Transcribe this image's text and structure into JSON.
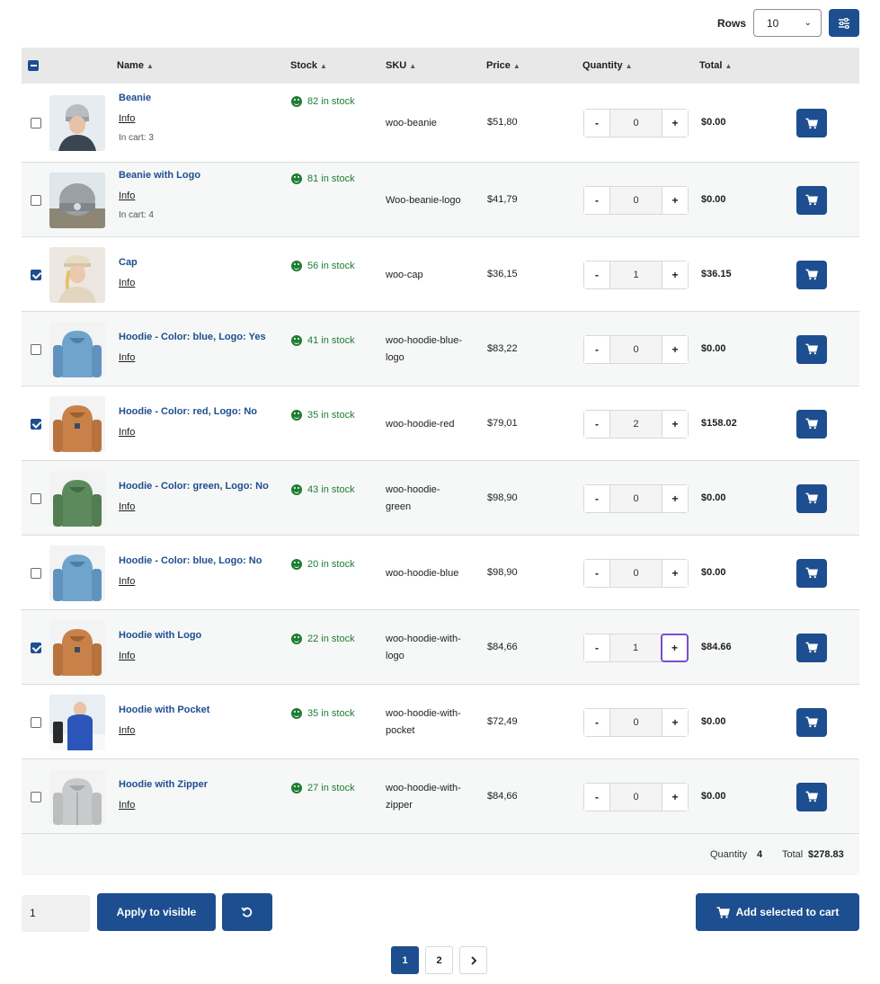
{
  "rows_control": {
    "label": "Rows",
    "value": "10"
  },
  "columns": {
    "name": "Name",
    "stock": "Stock",
    "sku": "SKU",
    "price": "Price",
    "quantity": "Quantity",
    "total": "Total"
  },
  "products": [
    {
      "name": "Beanie",
      "info": "Info",
      "in_cart": "In cart: 3",
      "stock": "82 in stock",
      "sku": [
        "woo-beanie"
      ],
      "price": "$51,80",
      "qty": "0",
      "total": "$0.00",
      "checked": false,
      "thumb": "beanie"
    },
    {
      "name": "Beanie with Logo",
      "info": "Info",
      "in_cart": "In cart: 4",
      "stock": "81 in stock",
      "sku": [
        "Woo-beanie-logo"
      ],
      "price": "$41,79",
      "qty": "0",
      "total": "$0.00",
      "checked": false,
      "thumb": "beanie-logo"
    },
    {
      "name": "Cap",
      "info": "Info",
      "in_cart": "",
      "stock": "56 in stock",
      "sku": [
        "woo-cap"
      ],
      "price": "$36,15",
      "qty": "1",
      "total": "$36.15",
      "checked": true,
      "thumb": "cap"
    },
    {
      "name": "Hoodie - Color: blue, Logo: Yes",
      "info": "Info",
      "in_cart": "",
      "stock": "41 in stock",
      "sku": [
        "woo-hoodie-blue-",
        "logo"
      ],
      "price": "$83,22",
      "qty": "0",
      "total": "$0.00",
      "checked": false,
      "thumb": "hoodie-blue"
    },
    {
      "name": "Hoodie - Color: red, Logo: No",
      "info": "Info",
      "in_cart": "",
      "stock": "35 in stock",
      "sku": [
        "woo-hoodie-red"
      ],
      "price": "$79,01",
      "qty": "2",
      "total": "$158.02",
      "checked": true,
      "thumb": "hoodie-orange"
    },
    {
      "name": "Hoodie - Color: green, Logo: No",
      "info": "Info",
      "in_cart": "",
      "stock": "43 in stock",
      "sku": [
        "woo-hoodie-",
        "green"
      ],
      "price": "$98,90",
      "qty": "0",
      "total": "$0.00",
      "checked": false,
      "thumb": "hoodie-green"
    },
    {
      "name": "Hoodie - Color: blue, Logo: No",
      "info": "Info",
      "in_cart": "",
      "stock": "20 in stock",
      "sku": [
        "woo-hoodie-blue"
      ],
      "price": "$98,90",
      "qty": "0",
      "total": "$0.00",
      "checked": false,
      "thumb": "hoodie-blue"
    },
    {
      "name": "Hoodie with Logo",
      "info": "Info",
      "in_cart": "",
      "stock": "22 in stock",
      "sku": [
        "woo-hoodie-with-",
        "logo"
      ],
      "price": "$84,66",
      "qty": "1",
      "total": "$84.66",
      "checked": true,
      "thumb": "hoodie-orange",
      "plus_focused": true
    },
    {
      "name": "Hoodie with Pocket",
      "info": "Info",
      "in_cart": "",
      "stock": "35 in stock",
      "sku": [
        "woo-hoodie-with-",
        "pocket"
      ],
      "price": "$72,49",
      "qty": "0",
      "total": "$0.00",
      "checked": false,
      "thumb": "hoodie-pocket"
    },
    {
      "name": "Hoodie with Zipper",
      "info": "Info",
      "in_cart": "",
      "stock": "27 in stock",
      "sku": [
        "woo-hoodie-with-",
        "zipper"
      ],
      "price": "$84,66",
      "qty": "0",
      "total": "$0.00",
      "checked": false,
      "thumb": "hoodie-gray"
    }
  ],
  "summary": {
    "quantity_label": "Quantity",
    "quantity_value": "4",
    "total_label": "Total",
    "total_value": "$278.83"
  },
  "bulk": {
    "input_value": "1",
    "apply_label": "Apply to visible",
    "add_selected_label": "Add selected to cart"
  },
  "pagination": {
    "pages": [
      "1",
      "2"
    ],
    "current": "1"
  },
  "colors": {
    "primary": "#1d4e8f",
    "in_stock": "#1e7d32",
    "focus": "#7c4dcc",
    "row_alt": "#f6f7f7",
    "header_bg": "#e8e8e8"
  }
}
